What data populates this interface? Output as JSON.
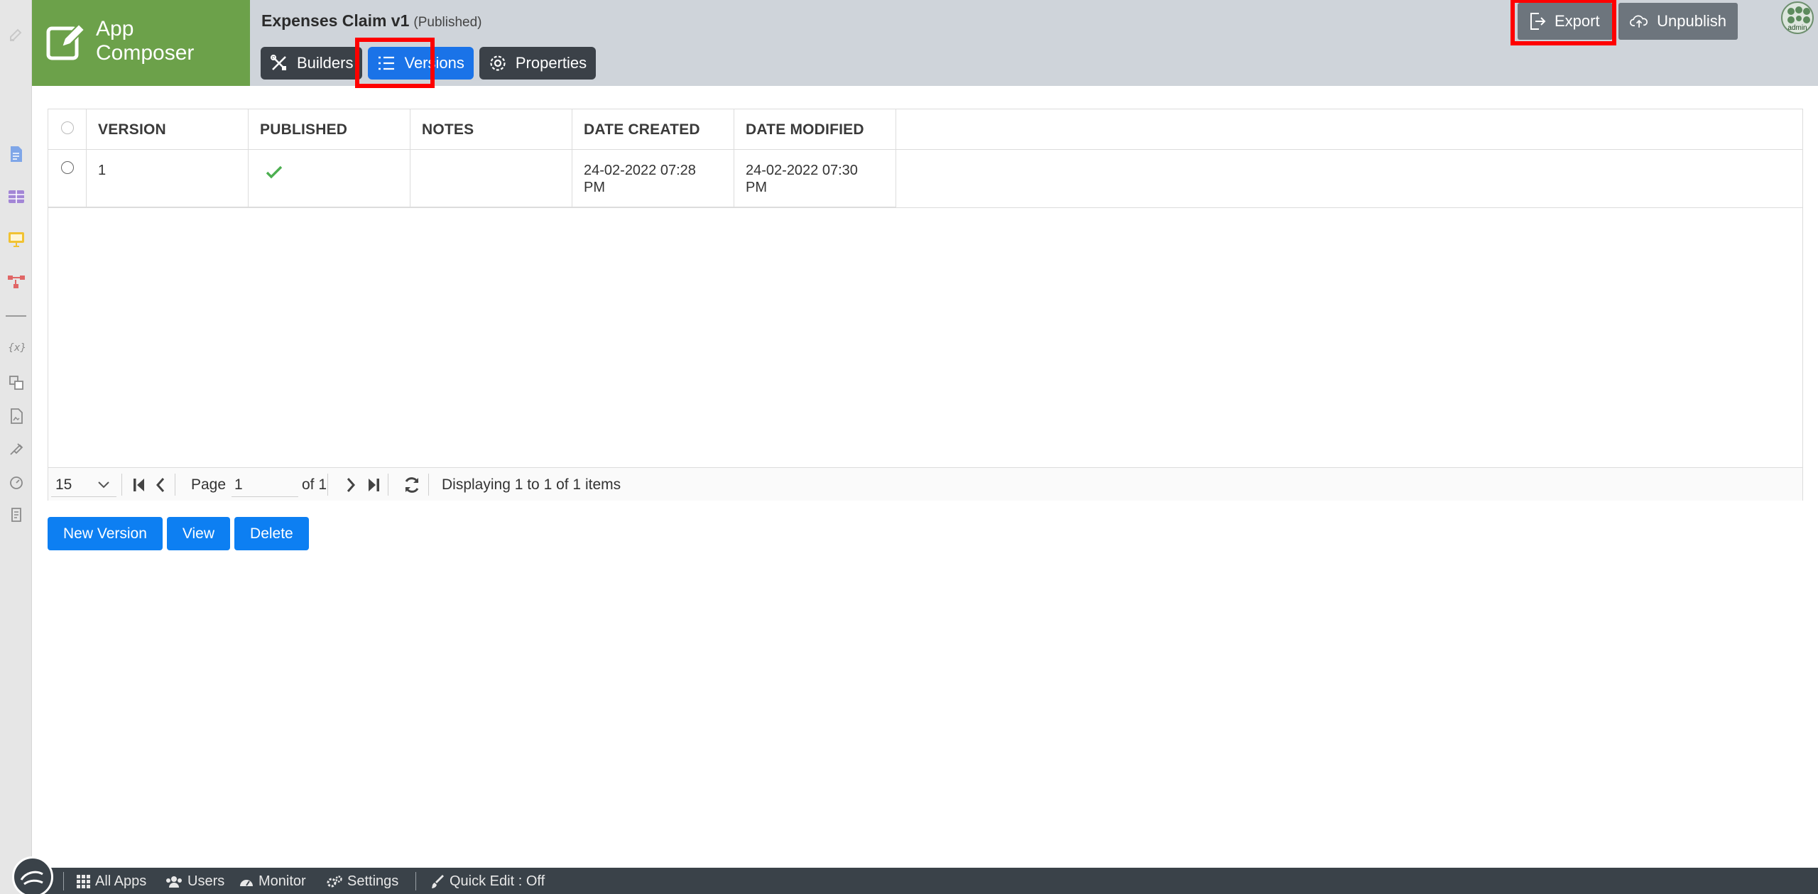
{
  "brand": {
    "line1": "App",
    "line2": "Composer",
    "color": "#6ca14a"
  },
  "app": {
    "name": "Expenses Claim v1",
    "status": "(Published)"
  },
  "tabs": [
    {
      "label": "Builders",
      "icon": "tools-icon"
    },
    {
      "label": "Versions",
      "icon": "list-icon",
      "active": true
    },
    {
      "label": "Properties",
      "icon": "gear-icon"
    }
  ],
  "header_buttons": {
    "export": "Export",
    "unpublish": "Unpublish"
  },
  "avatar": {
    "label": "admin"
  },
  "grid": {
    "columns": [
      "VERSION",
      "PUBLISHED",
      "NOTES",
      "DATE CREATED",
      "DATE MODIFIED"
    ],
    "rows": [
      {
        "version": "1",
        "published": true,
        "notes": "",
        "date_created": "24-02-2022 07:28 PM",
        "date_modified": "24-02-2022 07:30 PM"
      }
    ]
  },
  "pager": {
    "page_size": "15",
    "page_label": "Page",
    "page_value": "1",
    "of_label": "of 1",
    "display_text": "Displaying 1 to 1 of 1 items"
  },
  "actions": {
    "new_version": "New Version",
    "view": "View",
    "delete": "Delete"
  },
  "footer": {
    "all_apps": "All Apps",
    "users": "Users",
    "monitor": "Monitor",
    "settings": "Settings",
    "quick_edit": "Quick Edit : Off"
  },
  "colors": {
    "accent": "#1a73e8",
    "button": "#0d7ff2",
    "highlight": "#ff0000",
    "footer": "#3a4249"
  }
}
